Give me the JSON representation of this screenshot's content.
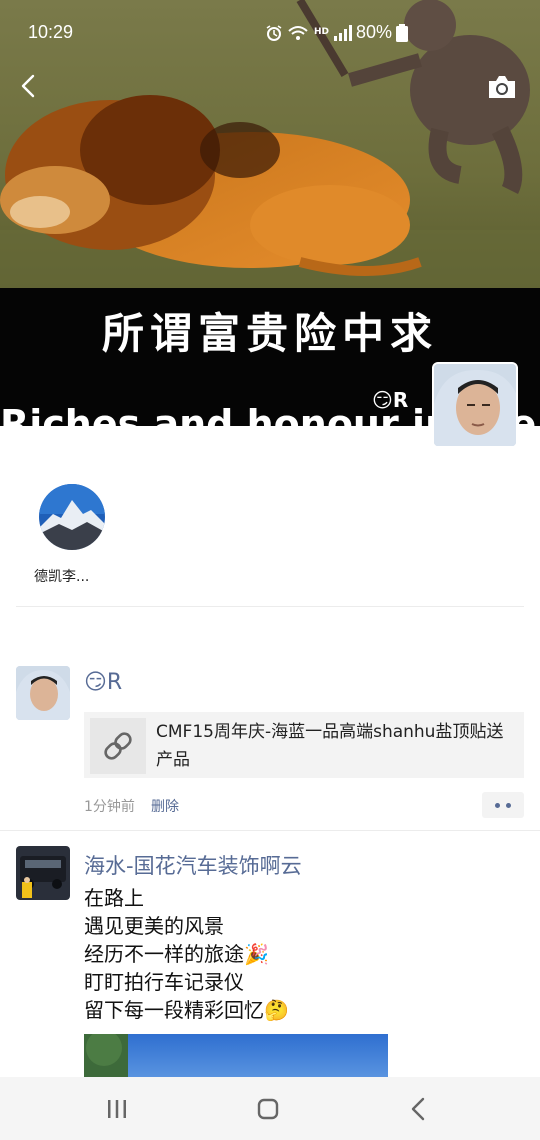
{
  "status_bar": {
    "time": "10:29",
    "battery": "80%",
    "icons": [
      "alarm-icon",
      "wifi-icon",
      "hd-icon",
      "4g-signal-icon",
      "battery-icon"
    ]
  },
  "cover": {
    "caption_cn": "所谓富贵险中求",
    "caption_en_partial": "Riches and honour in the"
  },
  "header": {
    "back_icon": "chevron-left-icon",
    "camera_icon": "camera-icon"
  },
  "profile": {
    "name": "😏R"
  },
  "story": {
    "label": "德凯李..."
  },
  "posts": [
    {
      "name": "😏R",
      "link_icon": "link-icon",
      "link_title": "CMF15周年庆-海蓝一品高端shanhu盐顶贴送产品",
      "time": "1分钟前",
      "delete": "删除",
      "more_icon": "more-dots-icon"
    },
    {
      "name": "海水-国花汽车装饰啊云",
      "lines": [
        "在路上",
        "遇见更美的风景",
        "经历不一样的旅途🎉",
        "盯盯拍行车记录仪",
        "留下每一段精彩回忆🤔"
      ]
    }
  ],
  "nav": {
    "recents_icon": "recent-apps-icon",
    "home_icon": "home-icon",
    "back_icon": "back-icon"
  },
  "colors": {
    "link_blue": "#576b95",
    "divider": "#ececec",
    "card_bg": "#f3f3f3"
  }
}
